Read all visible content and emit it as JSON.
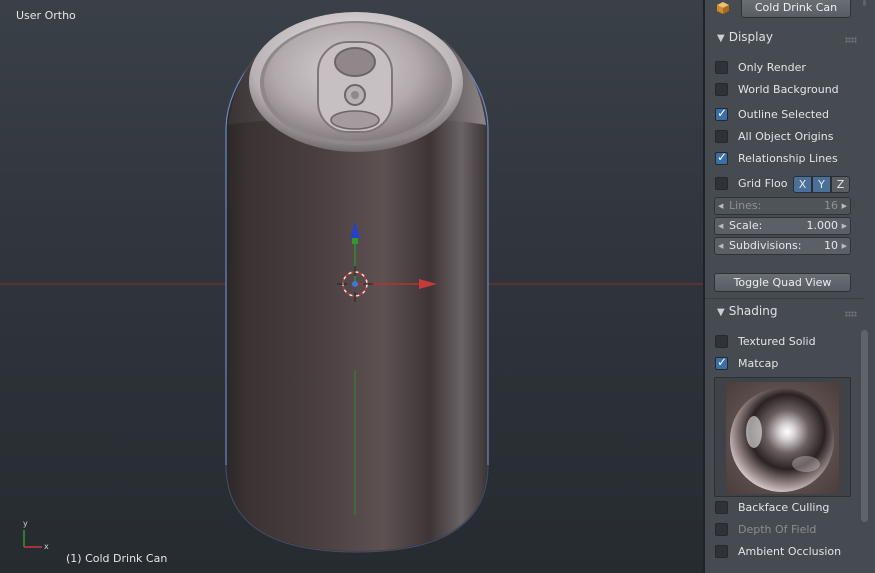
{
  "viewport": {
    "view_name": "User Ortho",
    "object_label": "(1) Cold Drink Can"
  },
  "panel": {
    "object_name": "Cold Drink Can",
    "object_icon": "cube-icon",
    "display": {
      "title": "Display",
      "only_render": "Only Render",
      "world_background": "World Background",
      "outline_selected": "Outline Selected",
      "all_object_origins": "All Object Origins",
      "relationship_lines": "Relationship Lines",
      "grid_floor": "Grid Floo",
      "axes": [
        "X",
        "Y",
        "Z"
      ],
      "lines_label": "Lines:",
      "lines_value": "16",
      "scale_label": "Scale:",
      "scale_value": "1.000",
      "subdivisions_label": "Subdivisions:",
      "subdivisions_value": "10",
      "toggle_quad_view": "Toggle Quad View"
    },
    "shading": {
      "title": "Shading",
      "textured_solid": "Textured Solid",
      "matcap": "Matcap",
      "backface_culling": "Backface Culling",
      "depth_of_field": "Depth Of Field",
      "ambient_occlusion": "Ambient Occlusion"
    }
  },
  "colors": {
    "accent": "#3d6fa7",
    "panel_bg": "#464b51",
    "viewport_bg": "#2f353b",
    "x_axis": "#c83a3a",
    "y_axis": "#3aa83a",
    "z_axis": "#2a3fc8"
  }
}
